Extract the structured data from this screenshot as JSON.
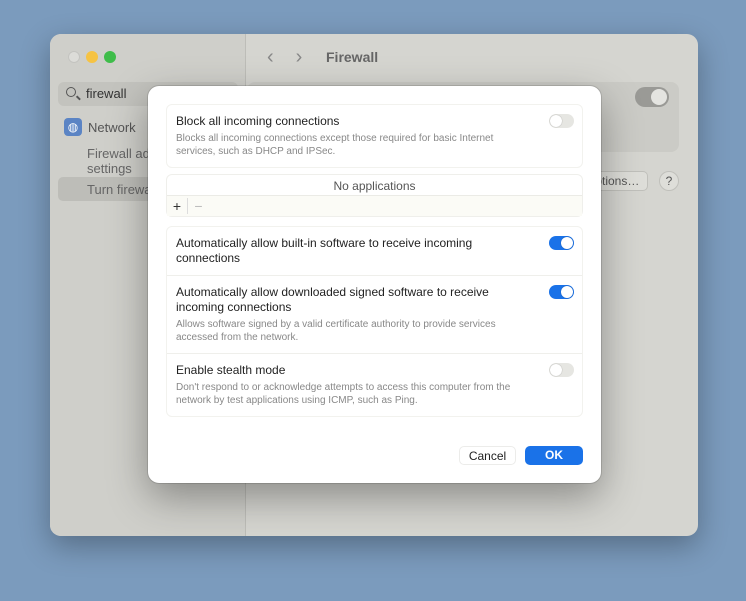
{
  "window": {
    "title": "Firewall",
    "back_icon": "chevron-left",
    "forward_icon": "chevron-right"
  },
  "sidebar": {
    "search_value": "firewall",
    "items": [
      {
        "label": "Network",
        "icon": "globe-icon"
      },
      {
        "label": "Firewall advanced settings"
      },
      {
        "label": "Turn firewall on or off"
      }
    ]
  },
  "main": {
    "options_label": "Options…",
    "help_label": "?",
    "firewall_enabled": true
  },
  "dialog": {
    "block_all": {
      "label": "Block all incoming connections",
      "desc": "Blocks all incoming connections except those required for basic Internet services, such as DHCP and IPSec.",
      "on": false
    },
    "apps": {
      "empty": "No applications",
      "add": "+",
      "remove": "−"
    },
    "builtin": {
      "label": "Automatically allow built-in software to receive incoming connections",
      "on": true
    },
    "signed": {
      "label": "Automatically allow downloaded signed software to receive incoming connections",
      "desc": "Allows software signed by a valid certificate authority to provide services accessed from the network.",
      "on": true
    },
    "stealth": {
      "label": "Enable stealth mode",
      "desc": "Don't respond to or acknowledge attempts to access this computer from the network by test applications using ICMP, such as Ping.",
      "on": false
    },
    "cancel": "Cancel",
    "ok": "OK"
  },
  "colors": {
    "accent": "#1a72e8",
    "desktop": "#7b9bbd"
  }
}
